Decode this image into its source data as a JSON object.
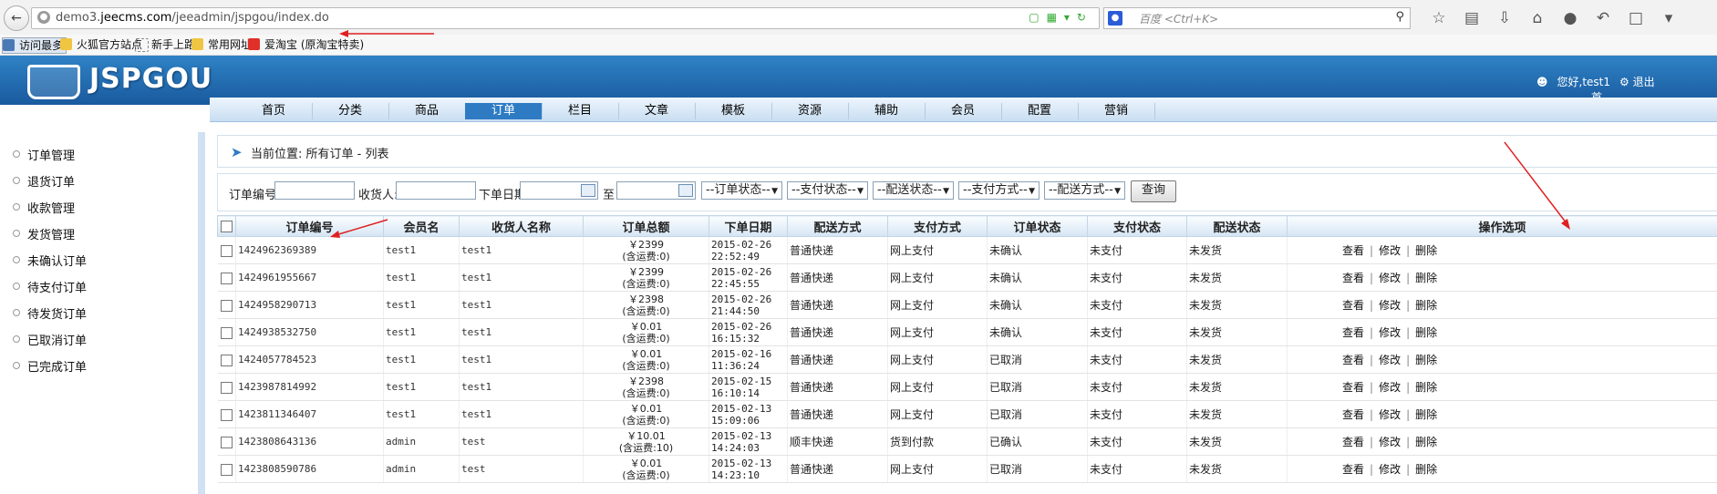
{
  "browser": {
    "url_prefix": "demo3.",
    "url_domain": "jeecms.com",
    "url_path": "/jeeadmin/jspgou/index.do",
    "search_placeholder": "百度 <Ctrl+K>",
    "bookmarks": [
      "访问最多",
      "火狐官方站点",
      "新手上路",
      "常用网址",
      "爱淘宝 (原淘宝特卖)"
    ]
  },
  "header": {
    "logo_text": "JSPGOU",
    "greeting": "您好,test1",
    "logout": "退出",
    "home_link": "首"
  },
  "mainnav": [
    "首页",
    "分类",
    "商品",
    "订单",
    "栏目",
    "文章",
    "模板",
    "资源",
    "辅助",
    "会员",
    "配置",
    "营销"
  ],
  "mainnav_active": 3,
  "sidebar": [
    "订单管理",
    "退货订单",
    "收款管理",
    "发货管理",
    "未确认订单",
    "待支付订单",
    "待发货订单",
    "已取消订单",
    "已完成订单"
  ],
  "breadcrumb": "当前位置: 所有订单 - 列表",
  "filter": {
    "order_no_label": "订单编号:",
    "receiver_label": "收货人:",
    "date_label": "下单日期:",
    "to_label": "至",
    "order_status": "--订单状态--",
    "pay_status": "--支付状态--",
    "ship_status": "--配送状态--",
    "pay_method": "--支付方式--",
    "ship_method": "--配送方式--",
    "query_button": "查询"
  },
  "table": {
    "headers": [
      "订单编号",
      "会员名",
      "收货人名称",
      "订单总额",
      "下单日期",
      "配送方式",
      "支付方式",
      "订单状态",
      "支付状态",
      "配送状态",
      "操作选项"
    ],
    "actions": [
      "查看",
      "修改",
      "删除"
    ],
    "rows": [
      {
        "no": "1424962369389",
        "member": "test1",
        "receiver": "test1",
        "amount": "￥2399",
        "freight": "(含运费:0)",
        "date": "2015-02-26",
        "time": "22:52:49",
        "ship": "普通快递",
        "pay": "网上支付",
        "status": "未确认",
        "paystatus": "未支付",
        "shipstatus": "未发货"
      },
      {
        "no": "1424961955667",
        "member": "test1",
        "receiver": "test1",
        "amount": "￥2399",
        "freight": "(含运费:0)",
        "date": "2015-02-26",
        "time": "22:45:55",
        "ship": "普通快递",
        "pay": "网上支付",
        "status": "未确认",
        "paystatus": "未支付",
        "shipstatus": "未发货"
      },
      {
        "no": "1424958290713",
        "member": "test1",
        "receiver": "test1",
        "amount": "￥2398",
        "freight": "(含运费:0)",
        "date": "2015-02-26",
        "time": "21:44:50",
        "ship": "普通快递",
        "pay": "网上支付",
        "status": "未确认",
        "paystatus": "未支付",
        "shipstatus": "未发货"
      },
      {
        "no": "1424938532750",
        "member": "test1",
        "receiver": "test1",
        "amount": "￥0.01",
        "freight": "(含运费:0)",
        "date": "2015-02-26",
        "time": "16:15:32",
        "ship": "普通快递",
        "pay": "网上支付",
        "status": "未确认",
        "paystatus": "未支付",
        "shipstatus": "未发货"
      },
      {
        "no": "1424057784523",
        "member": "test1",
        "receiver": "test1",
        "amount": "￥0.01",
        "freight": "(含运费:0)",
        "date": "2015-02-16",
        "time": "11:36:24",
        "ship": "普通快递",
        "pay": "网上支付",
        "status": "已取消",
        "paystatus": "未支付",
        "shipstatus": "未发货"
      },
      {
        "no": "1423987814992",
        "member": "test1",
        "receiver": "test1",
        "amount": "￥2398",
        "freight": "(含运费:0)",
        "date": "2015-02-15",
        "time": "16:10:14",
        "ship": "普通快递",
        "pay": "网上支付",
        "status": "已取消",
        "paystatus": "未支付",
        "shipstatus": "未发货"
      },
      {
        "no": "1423811346407",
        "member": "test1",
        "receiver": "test1",
        "amount": "￥0.01",
        "freight": "(含运费:0)",
        "date": "2015-02-13",
        "time": "15:09:06",
        "ship": "普通快递",
        "pay": "网上支付",
        "status": "已取消",
        "paystatus": "未支付",
        "shipstatus": "未发货"
      },
      {
        "no": "1423808643136",
        "member": "admin",
        "receiver": "test",
        "amount": "￥10.01",
        "freight": "(含运费:10)",
        "date": "2015-02-13",
        "time": "14:24:03",
        "ship": "顺丰快递",
        "pay": "货到付款",
        "status": "已确认",
        "paystatus": "未支付",
        "shipstatus": "未发货"
      },
      {
        "no": "1423808590786",
        "member": "admin",
        "receiver": "test",
        "amount": "￥0.01",
        "freight": "(含运费:0)",
        "date": "2015-02-13",
        "time": "14:23:10",
        "ship": "普通快递",
        "pay": "网上支付",
        "status": "已取消",
        "paystatus": "未支付",
        "shipstatus": "未发货"
      }
    ]
  },
  "colors": {
    "header_blue": "#1a5a9e",
    "accent": "#2e7bc4",
    "annotation_red": "#e02020"
  }
}
